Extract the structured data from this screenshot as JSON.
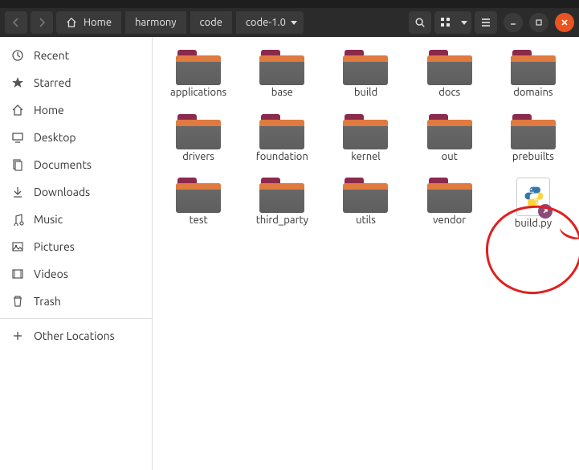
{
  "titlebar_text": "",
  "toolbar": {
    "home_label": "Home",
    "breadcrumbs": [
      "harmony",
      "code",
      "code-1.0"
    ]
  },
  "sidebar": {
    "items": [
      {
        "icon": "recent",
        "label": "Recent"
      },
      {
        "icon": "star",
        "label": "Starred"
      },
      {
        "icon": "home",
        "label": "Home"
      },
      {
        "icon": "desktop",
        "label": "Desktop"
      },
      {
        "icon": "documents",
        "label": "Documents"
      },
      {
        "icon": "downloads",
        "label": "Downloads"
      },
      {
        "icon": "music",
        "label": "Music"
      },
      {
        "icon": "pictures",
        "label": "Pictures"
      },
      {
        "icon": "videos",
        "label": "Videos"
      },
      {
        "icon": "trash",
        "label": "Trash"
      }
    ],
    "other_locations": "Other Locations"
  },
  "files": [
    {
      "type": "folder",
      "name": "applications"
    },
    {
      "type": "folder",
      "name": "base"
    },
    {
      "type": "folder",
      "name": "build"
    },
    {
      "type": "folder",
      "name": "docs"
    },
    {
      "type": "folder",
      "name": "domains"
    },
    {
      "type": "folder",
      "name": "drivers"
    },
    {
      "type": "folder",
      "name": "foundation"
    },
    {
      "type": "folder",
      "name": "kernel"
    },
    {
      "type": "folder",
      "name": "out"
    },
    {
      "type": "folder",
      "name": "prebuilts"
    },
    {
      "type": "folder",
      "name": "test"
    },
    {
      "type": "folder",
      "name": "third_party"
    },
    {
      "type": "folder",
      "name": "utils"
    },
    {
      "type": "folder",
      "name": "vendor"
    },
    {
      "type": "python-link",
      "name": "build.py"
    }
  ],
  "annotation": {
    "circled_file": "build.py"
  }
}
